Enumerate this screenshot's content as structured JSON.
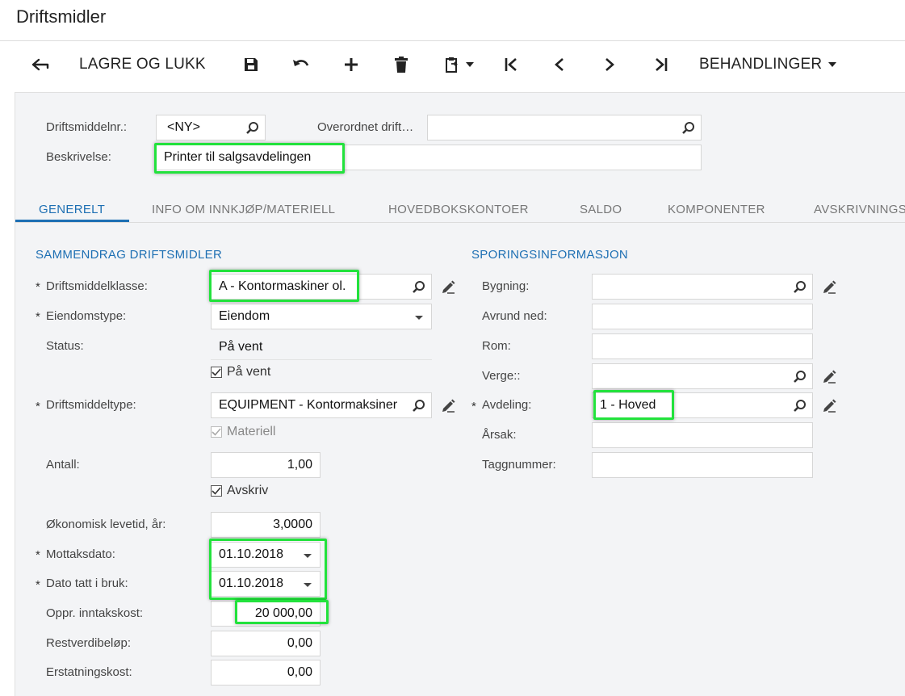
{
  "page": {
    "title": "Driftsmidler"
  },
  "toolbar": {
    "save_close_label": "LAGRE OG LUKK",
    "actions_label": "BEHANDLINGER",
    "icons": [
      "back-arrow-icon",
      "save-icon",
      "undo-icon",
      "add-icon",
      "delete-icon",
      "clipboard-icon",
      "first-record-icon",
      "previous-record-icon",
      "next-record-icon",
      "last-record-icon"
    ]
  },
  "header": {
    "asset_no_label": "Driftsmiddelnr.:",
    "asset_no_value": "<NY>",
    "parent_label": "Overordnet drift…",
    "parent_value": "",
    "description_label": "Beskrivelse:",
    "description_value": "Printer til salgsavdelingen"
  },
  "tabs": [
    {
      "label": "GENERELT",
      "active": true
    },
    {
      "label": "INFO OM INNKJØP/MATERIELL"
    },
    {
      "label": "HOVEDBOKSKONTOER"
    },
    {
      "label": "SALDO"
    },
    {
      "label": "KOMPONENTER"
    },
    {
      "label": "AVSKRIVNINGS"
    }
  ],
  "summary": {
    "title": "SAMMENDRAG DRIFTSMIDLER",
    "required_marker": "*",
    "asset_class_label": "Driftsmiddelklasse:",
    "asset_class_value": "A - Kontormaskiner ol.",
    "property_type_label": "Eiendomstype:",
    "property_type_value": "Eiendom",
    "status_label": "Status:",
    "status_value": "På vent",
    "on_hold_label": "På vent",
    "on_hold_checked": true,
    "asset_type_label": "Driftsmiddeltype:",
    "asset_type_value": "EQUIPMENT - Kontormaksiner",
    "material_label": "Materiell",
    "material_checked": true,
    "quantity_label": "Antall:",
    "quantity_value": "1,00",
    "depreciate_label": "Avskriv",
    "depreciate_checked": true,
    "useful_life_label": "Økonomisk levetid, år:",
    "useful_life_value": "3,0000",
    "receipt_date_label": "Mottaksdato:",
    "receipt_date_value": "01.10.2018",
    "placed_in_service_label": "Dato tatt i bruk:",
    "placed_in_service_value": "01.10.2018",
    "orig_cost_label": "Oppr. inntakskost:",
    "orig_cost_value": "20 000,00",
    "salvage_label": "Restverdibeløp:",
    "salvage_value": "0,00",
    "replacement_label": "Erstatningskost:",
    "replacement_value": "0,00"
  },
  "tracking": {
    "title": "SPORINGSINFORMASJON",
    "building_label": "Bygning:",
    "building_value": "",
    "floor_label": "Avrund ned:",
    "floor_value": "",
    "room_label": "Rom:",
    "room_value": "",
    "custodian_label": "Verge::",
    "custodian_value": "",
    "department_label": "Avdeling:",
    "department_value": "1 - Hoved",
    "reason_label": "Årsak:",
    "reason_value": "",
    "tag_label": "Taggnummer:",
    "tag_value": ""
  },
  "colors": {
    "accent": "#1d6fb3",
    "highlight": "#22e23c",
    "panel_bg": "#f3f4f6"
  }
}
